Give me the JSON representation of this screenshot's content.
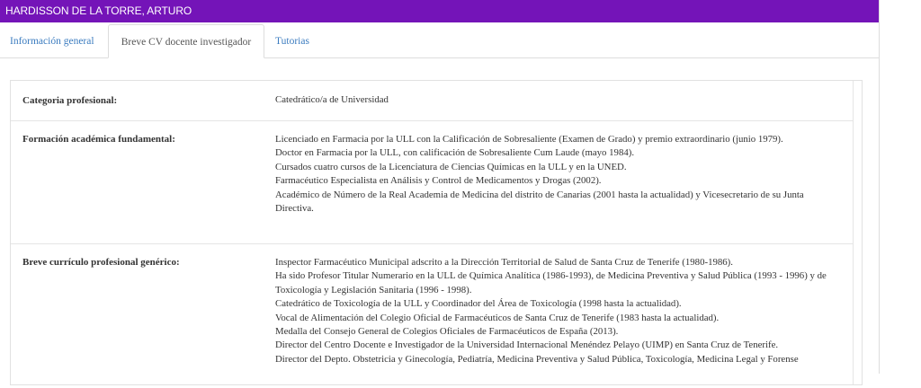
{
  "header": {
    "title": "HARDISSON DE LA TORRE, ARTURO"
  },
  "tabs": [
    {
      "label": "Información general",
      "active": false
    },
    {
      "label": "Breve CV docente investigador",
      "active": true
    },
    {
      "label": "Tutorias",
      "active": false
    }
  ],
  "rows": [
    {
      "label": "Categoria profesional:",
      "lines": [
        "Catedrático/a de Universidad"
      ]
    },
    {
      "label": "Formación académica fundamental:",
      "lines": [
        "Licenciado en Farmacia por la ULL con la Calificación de Sobresaliente (Examen de Grado) y premio extraordinario (junio 1979).",
        "Doctor en Farmacia por la ULL, con calificación de Sobresaliente Cum Laude (mayo 1984).",
        "Cursados cuatro cursos de la Licenciatura de Ciencias Químicas en la ULL y en la UNED.",
        "Farmacéutico Especialista en Análisis y Control de Medicamentos y Drogas (2002).",
        "Académico de Número de la Real Academia de Medicina del distrito de Canarias (2001 hasta la actualidad) y Vicesecretario de su Junta Directiva."
      ]
    },
    {
      "label": "Breve currículo profesional genérico:",
      "lines": [
        "Inspector Farmacéutico Municipal adscrito a la Dirección Territorial de Salud de Santa Cruz de Tenerife (1980-1986).",
        "Ha sido Profesor Titular Numerario en la ULL de Química Analítica (1986-1993), de Medicina Preventiva y Salud Pública (1993 - 1996) y de Toxicología y Legislación Sanitaria (1996 - 1998).",
        "Catedrático de Toxicología de la ULL y Coordinador del Área de Toxicología (1998 hasta la actualidad).",
        "Vocal de Alimentación del Colegio Oficial de Farmacéuticos de Santa Cruz de Tenerife (1983 hasta la actualidad).",
        "Medalla del Consejo General de Colegios Oficiales de Farmacéuticos de España (2013).",
        "Director del Centro Docente e Investigador de la Universidad Internacional Menéndez Pelayo (UIMP) en Santa Cruz de Tenerife.",
        "Director del Depto. Obstetricia y Ginecología, Pediatría, Medicina Preventiva y Salud Pública, Toxicología, Medicina Legal y Forense"
      ]
    }
  ]
}
